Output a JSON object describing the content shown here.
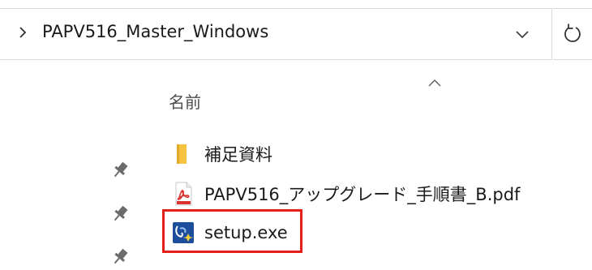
{
  "address_bar": {
    "path": "PAPV516_Master_Windows"
  },
  "file_list": {
    "column_name": "名前",
    "items": [
      {
        "label": "補足資料",
        "icon": "folder-icon"
      },
      {
        "label": "PAPV516_アップグレード_手順書_B.pdf",
        "icon": "pdf-icon"
      },
      {
        "label": "setup.exe",
        "icon": "installer-icon"
      }
    ]
  },
  "colors": {
    "highlight": "#e32119",
    "folder": "#f5c242",
    "pdf": "#d8332c",
    "installer": "#1c4e9c"
  }
}
